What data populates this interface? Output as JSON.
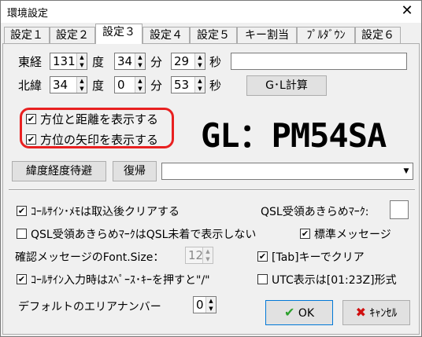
{
  "window": {
    "title": "環境設定",
    "close": "✕"
  },
  "tabs": [
    "設定１",
    "設定２",
    "設定３",
    "設定４",
    "設定５",
    "キー割当",
    "ﾌﾟﾙﾀﾞｳﾝ",
    "設定６"
  ],
  "active_tab": "設定３",
  "coords": {
    "east_label": "東経",
    "north_label": "北緯",
    "deg": "度",
    "min": "分",
    "sec": "秒",
    "east": {
      "deg": "131",
      "min": "34",
      "sec": "29"
    },
    "north": {
      "deg": "34",
      "min": "0",
      "sec": "53"
    },
    "gl_button": "G･L計算"
  },
  "options": {
    "show_bearing": "方位と距離を表示する",
    "show_arrow": "方位の矢印を表示する"
  },
  "grid_locator": "GL：PM54SA",
  "buttons": {
    "wait_latlon": "緯度経度待避",
    "restore": "復帰",
    "ok": "OK",
    "cancel": "ｷｬﾝｾﾙ"
  },
  "settings": {
    "clear_call": "ｺｰﾙｻｲﾝ･ﾒﾓは取込後クリアする",
    "qsl_mark_label": "QSL受領あきらめﾏｰｸ:",
    "qsl_no_show": "QSL受領あきらめﾏｰｸはQSL未着で表示しない",
    "std_message": "標準メッセージ",
    "font_size_label": "確認メッセージのFont.Size：",
    "font_size_value": "12",
    "tab_clear": "[Tab]キーでクリア",
    "call_space": "ｺｰﾙｻｲﾝ入力時はｽﾍﾟｰｽ･ｷｰを押すと\"/\"",
    "utc_format": "UTC表示は[01:23Z]形式",
    "default_area_label": "デフォルトのエリアナンバー",
    "default_area_value": "0"
  },
  "colors": {
    "highlight": "#e82020",
    "ok_check": "#2ca02c",
    "cancel_x": "#d01010"
  }
}
